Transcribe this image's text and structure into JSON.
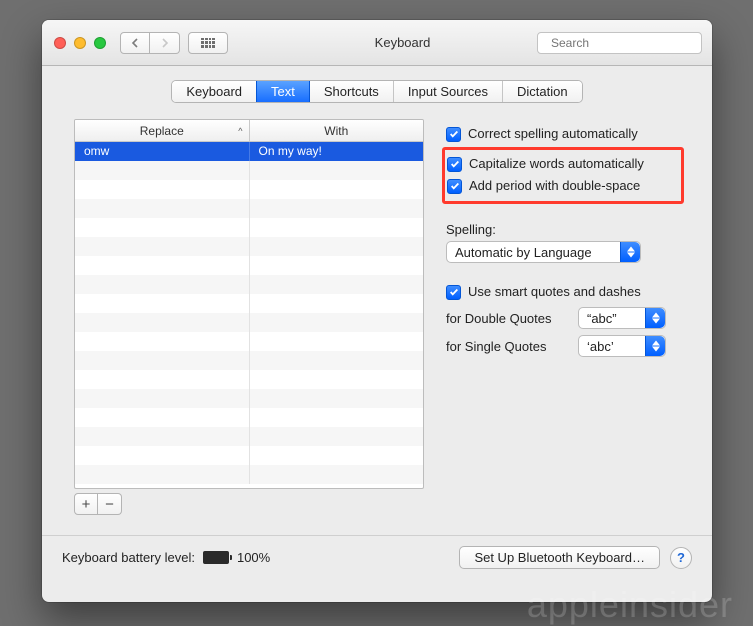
{
  "toolbar": {
    "title": "Keyboard",
    "search_placeholder": "Search"
  },
  "tabs": [
    "Keyboard",
    "Text",
    "Shortcuts",
    "Input Sources",
    "Dictation"
  ],
  "active_tab_index": 1,
  "table": {
    "columns": [
      "Replace",
      "With"
    ],
    "sort_indicator": "^",
    "rows": [
      {
        "replace": "omw",
        "with": "On my way!",
        "selected": true
      }
    ],
    "blank_rows": 17,
    "add_label": "+",
    "remove_label": "−"
  },
  "options": {
    "correct_spelling": {
      "label": "Correct spelling automatically",
      "checked": true
    },
    "capitalize": {
      "label": "Capitalize words automatically",
      "checked": true
    },
    "double_space": {
      "label": "Add period with double-space",
      "checked": true
    },
    "spelling_heading": "Spelling:",
    "spelling_value": "Automatic by Language",
    "smart_quotes": {
      "label": "Use smart quotes and dashes",
      "checked": true
    },
    "double_quotes_label": "for Double Quotes",
    "double_quotes_value": "“abc”",
    "single_quotes_label": "for Single Quotes",
    "single_quotes_value": "‘abc’"
  },
  "footer": {
    "battery_label": "Keyboard battery level:",
    "battery_pct": "100%",
    "bluetooth_button": "Set Up Bluetooth Keyboard…",
    "help_label": "?"
  },
  "watermark": "appleinsider"
}
